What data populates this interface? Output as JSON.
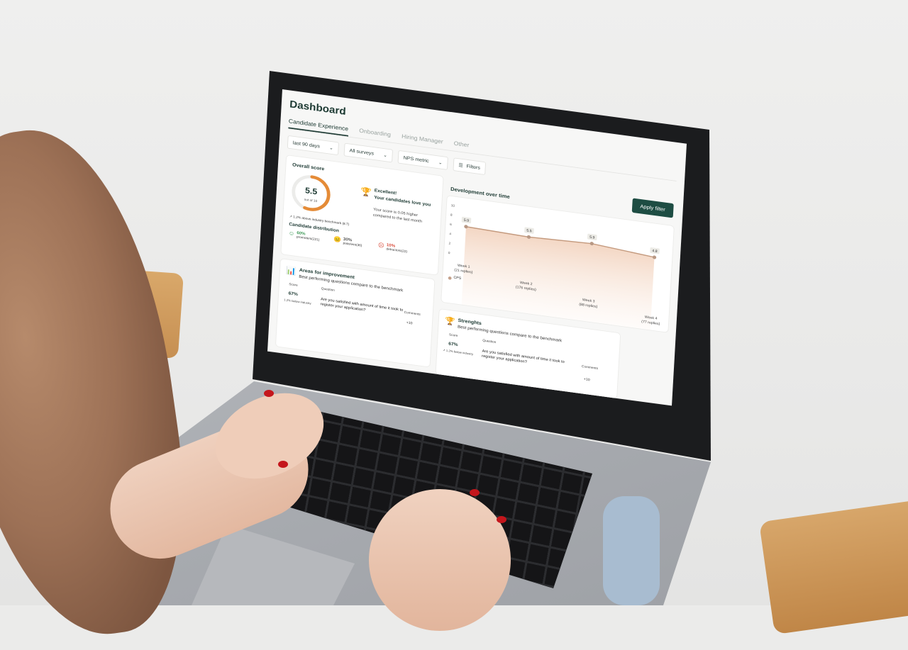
{
  "header": {
    "title": "Dashboard",
    "caret": "⌄"
  },
  "tabs": [
    {
      "label": "Candidate Experience",
      "active": true
    },
    {
      "label": "Onboarding",
      "active": false
    },
    {
      "label": "Hiring Manager",
      "active": false
    },
    {
      "label": "Other",
      "active": false
    }
  ],
  "filters": {
    "period": "last 90 days",
    "surveys": "All surveys",
    "metric": "NPS metric",
    "more": "Filters"
  },
  "apply_label": "Apply filter",
  "overall": {
    "title": "Overall score",
    "score": "5.5",
    "score_fraction": 0.55,
    "out_of": "out of 10",
    "benchmark": "↗ 1.2% above industry benchmark (8.7)",
    "headline1": "Excellent!",
    "headline2": "Your candidates love you",
    "detail": "Your score is 0.05 higher compared to the last month"
  },
  "distribution": {
    "title": "Candidate distribution",
    "items": [
      {
        "pct": "60%",
        "label": "promoters(221)",
        "color": "#3f9a58",
        "icon": "☺"
      },
      {
        "pct": "30%",
        "label": "passives(36)",
        "color": "#777777",
        "icon": "😐"
      },
      {
        "pct": "10%",
        "label": "detractors(22)",
        "color": "#d94b3a",
        "icon": "☹"
      }
    ]
  },
  "development": {
    "title": "Development over time",
    "legend": "CPS"
  },
  "chart_data": {
    "type": "area",
    "categories": [
      "Week 1",
      "Week 2",
      "Week 3",
      "Week 4"
    ],
    "replies": [
      "(21 replies)",
      "(176 replies)",
      "(88 replies)",
      "(77 replies)"
    ],
    "series": [
      {
        "name": "CPS",
        "values": [
          5.9,
          5.5,
          5.9,
          4.8
        ]
      }
    ],
    "ylim": [
      0,
      10
    ],
    "yticks": [
      "0",
      "2",
      "4",
      "6",
      "8",
      "10"
    ],
    "color": "#c49a7e"
  },
  "areas": {
    "title": "Areas for improvement",
    "subtitle": "Best performing questions compare to the benchmark",
    "col_score": "Score",
    "col_question": "Question",
    "col_comments": "Comments",
    "score": "67%",
    "question": "Are you satisfied with amount of time it took to register your application?",
    "below": "1.2% below industry",
    "comments": "+10"
  },
  "strengths": {
    "title": "Strenghts",
    "subtitle": "Best performing questions compare to the benchmark",
    "col_score": "Score",
    "col_question": "Question",
    "col_comments": "Comments",
    "score": "67%",
    "question": "Are you satisfied with amount of time it took to register your application?",
    "below": "↗ 1.2% below industry",
    "comments": "+10"
  }
}
